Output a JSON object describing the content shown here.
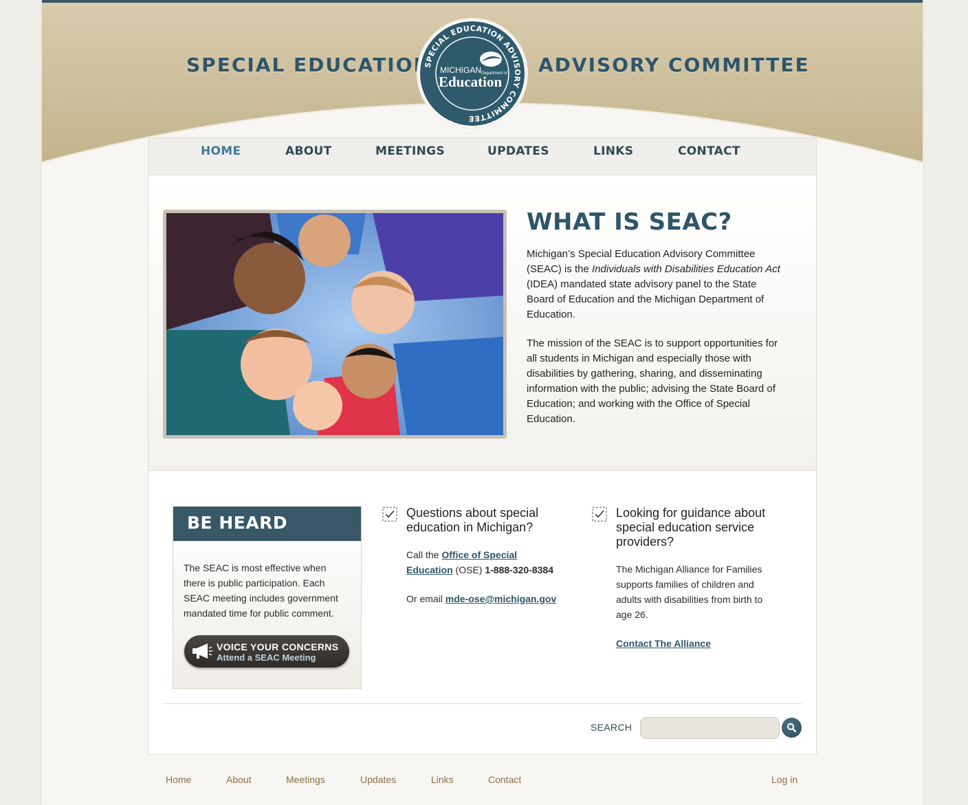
{
  "header": {
    "title_left": "SPECIAL EDUCATION",
    "title_right": "ADVISORY COMMITTEE",
    "seal": {
      "ring_text": "SPECIAL EDUCATION ADVISORY COMMITTEE",
      "line1": "MICHIGAN",
      "line2": "Department of",
      "line3": "Education"
    }
  },
  "nav": {
    "items": [
      {
        "label": "HOME",
        "active": true
      },
      {
        "label": "ABOUT",
        "active": false
      },
      {
        "label": "MEETINGS",
        "active": false
      },
      {
        "label": "UPDATES",
        "active": false
      },
      {
        "label": "LINKS",
        "active": false
      },
      {
        "label": "CONTACT",
        "active": false
      }
    ]
  },
  "hero": {
    "title": "WHAT IS SEAC?",
    "para1_before": "Michigan’s Special Education Advisory Committee (SEAC) is the ",
    "para1_italic": "Individuals with Disabilities Education Act",
    "para1_after": " (IDEA) mandated state advisory panel to the State Board of Education and the Michigan Department of Education.",
    "para2": "The mission of the SEAC is to support opportunities for all students in Michigan and especially those with disabilities by gathering, sharing, and disseminating information with the public; advising the State Board of Education; and working with the Office of Special Education."
  },
  "be_heard": {
    "title": "BE HEARD",
    "text": "The SEAC is most effective when there is public participation. Each SEAC meeting includes government mandated time for public comment.",
    "button_line1": "VOICE YOUR CONCERNS",
    "button_line2": "Attend a SEAC Meeting"
  },
  "questions": {
    "heading": "Questions about special education in Michigan?",
    "call_prefix": "Call the ",
    "ose_link": "Office of Special Education",
    "call_mid": " (OSE) ",
    "phone": "1-888-320-8384",
    "email_prefix": "Or email ",
    "email": "mde-ose@michigan.gov"
  },
  "guidance": {
    "heading": "Looking for guidance about special education service providers?",
    "text": "The Michigan Alliance for Families supports families of children and adults with disabilities from birth to age 26.",
    "link": "Contact The Alliance"
  },
  "search": {
    "label": "SEARCH",
    "placeholder": ""
  },
  "footer": {
    "links": [
      "Home",
      "About",
      "Meetings",
      "Updates",
      "Links",
      "Contact"
    ],
    "login": "Log in"
  },
  "colors": {
    "accent": "#2f5568",
    "header_tan": "#c9b994",
    "footer_link": "#8a6e45"
  }
}
